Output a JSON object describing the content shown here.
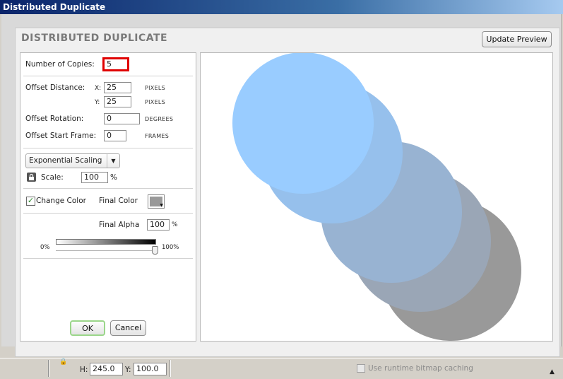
{
  "window": {
    "title": "Distributed Duplicate"
  },
  "dialog": {
    "heading": "DISTRIBUTED DUPLICATE",
    "update_preview_label": "Update Preview",
    "copies": {
      "label": "Number of Copies:",
      "value": "5"
    },
    "offset_distance": {
      "label": "Offset Distance:",
      "x_label": "X:",
      "x_value": "25",
      "x_unit": "PIXELS",
      "y_label": "Y:",
      "y_value": "25",
      "y_unit": "PIXELS"
    },
    "offset_rotation": {
      "label": "Offset Rotation:",
      "value": "0",
      "unit": "DEGREES"
    },
    "offset_start_frame": {
      "label": "Offset Start Frame:",
      "value": "0",
      "unit": "FRAMES"
    },
    "scaling": {
      "selected": "Exponential Scaling",
      "scale_label": "Scale:",
      "scale_value": "100",
      "scale_unit": "%"
    },
    "color": {
      "checkbox_label": "Change Color",
      "checked": true,
      "final_color_label": "Final Color",
      "final_color_value": "#999999"
    },
    "alpha": {
      "label": "Final Alpha",
      "value": "100",
      "unit": "%",
      "min_label": "0%",
      "max_label": "100%",
      "level": 1.0
    },
    "ok_label": "OK",
    "cancel_label": "Cancel",
    "preview_colors": [
      "#99ccff",
      "#96c0ec",
      "#98b3d2",
      "#9aa6b6",
      "#999999"
    ]
  },
  "properties_bar": {
    "h_label": "H:",
    "h_value": "245.0",
    "y_label": "Y:",
    "y_value": "100.0",
    "cache_label": "Use runtime bitmap caching"
  }
}
